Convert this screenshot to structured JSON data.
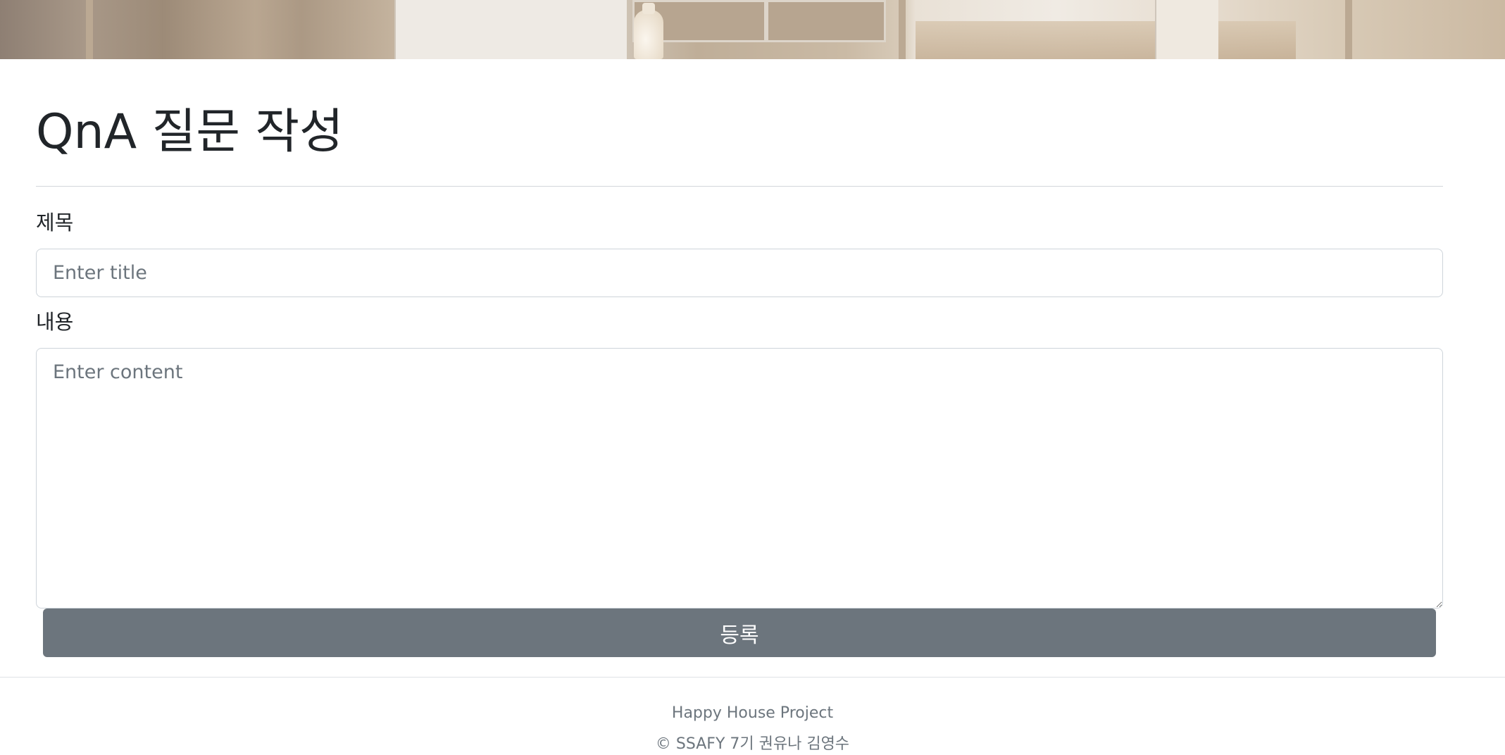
{
  "page": {
    "title": "QnA 질문 작성"
  },
  "form": {
    "title_label": "제목",
    "title_placeholder": "Enter title",
    "title_value": "",
    "content_label": "내용",
    "content_placeholder": "Enter content",
    "content_value": "",
    "submit_label": "등록"
  },
  "footer": {
    "project": "Happy House Project",
    "copyright": "© SSAFY 7기 권유나 김영수"
  },
  "colors": {
    "submit_button": "#6c757d",
    "footer_text": "#6c757d",
    "border": "#ced4da"
  }
}
